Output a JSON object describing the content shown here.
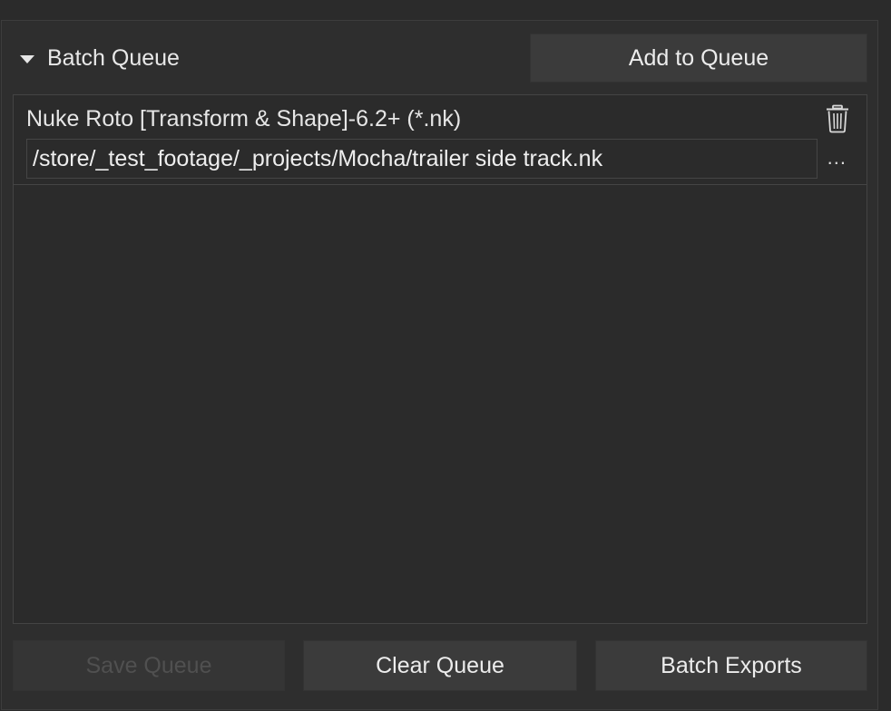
{
  "batch_queue": {
    "header_label": "Batch Queue",
    "add_button_label": "Add to Queue",
    "items": [
      {
        "format": "Nuke Roto [Transform & Shape]-6.2+ (*.nk)",
        "path": "/store/_test_footage/_projects/Mocha/trailer side track.nk",
        "browse_label": "..."
      }
    ],
    "footer": {
      "save_label": "Save Queue",
      "save_enabled": false,
      "clear_label": "Clear Queue",
      "export_label": "Batch Exports"
    }
  },
  "icons": {
    "collapse": "triangle-down-icon",
    "delete": "trash-icon"
  },
  "colors": {
    "background": "#2b2b2b",
    "button": "#3b3b3b",
    "text": "#e6e6e6",
    "disabled_text": "#505050"
  }
}
